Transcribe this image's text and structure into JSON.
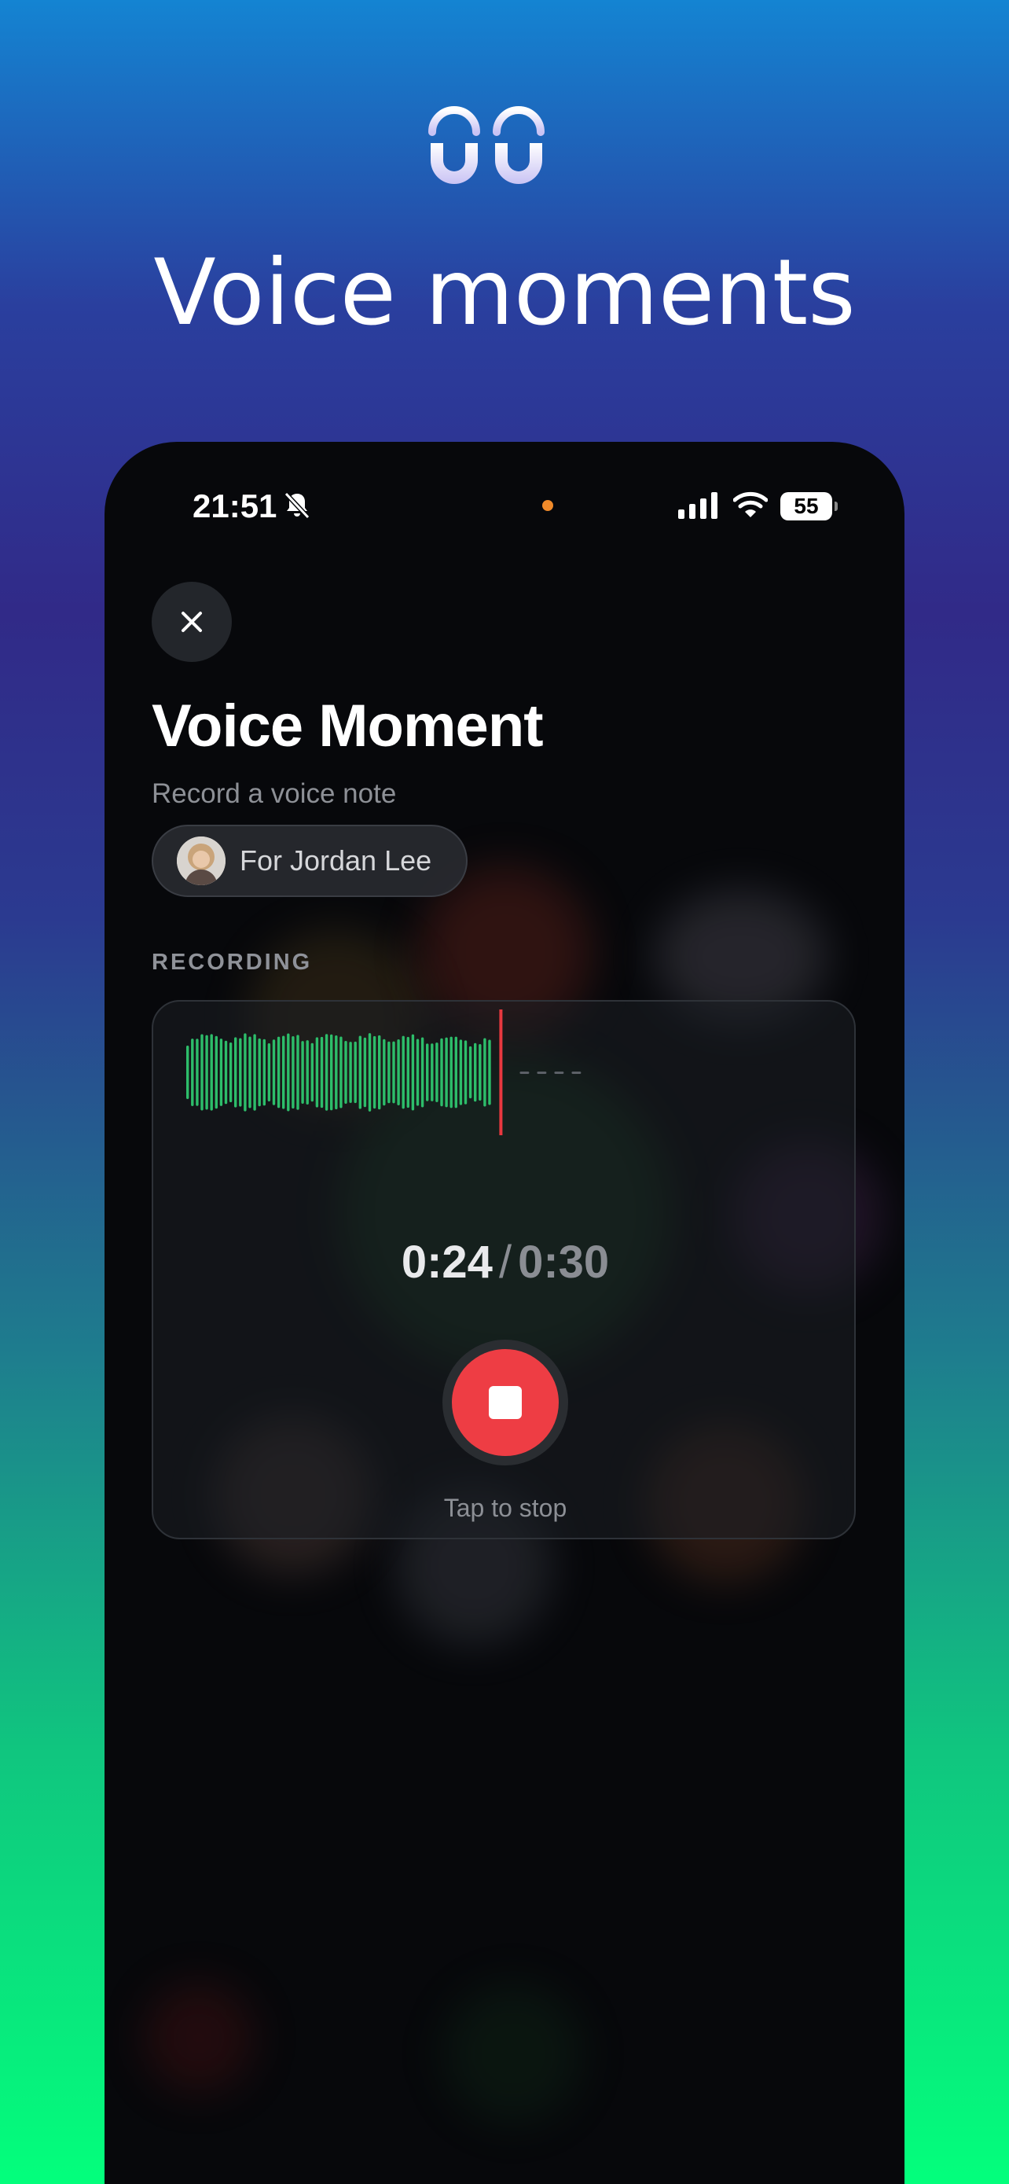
{
  "promo": {
    "headline": "Voice moments",
    "logo_icon": "double-arch-logo-icon"
  },
  "status_bar": {
    "time": "21:51",
    "silent_icon": "bell-slash-icon",
    "battery": "55",
    "recording_indicator_color": "#f08a2a"
  },
  "screen": {
    "close_icon": "close-icon",
    "title": "Voice Moment",
    "subtitle": "Record a voice note",
    "recipient_chip": "For Jordan Lee"
  },
  "recording": {
    "section_label": "RECORDING",
    "elapsed": "0:24",
    "separator": "/",
    "max": "0:30",
    "progress_fraction": 0.8,
    "stop_hint": "Tap to stop",
    "waveform_color": "#2dbd6a",
    "playhead_color": "#e8383f",
    "stop_button_color": "#ee3d44"
  }
}
